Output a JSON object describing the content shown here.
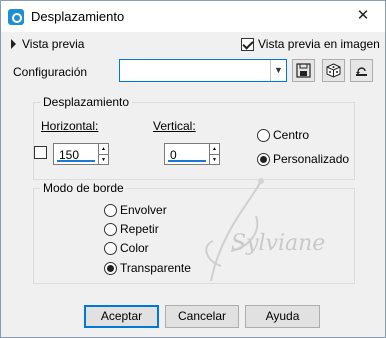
{
  "window": {
    "title": "Desplazamiento",
    "close_glyph": "✕"
  },
  "preview": {
    "toggle_label": "Vista previa",
    "image_preview_label": "Vista previa en imagen",
    "image_preview_checked": true
  },
  "config": {
    "label": "Configuración",
    "value": ""
  },
  "offset_group": {
    "title": "Desplazamiento",
    "horizontal_label": "Horizontal:",
    "vertical_label": "Vertical:",
    "horizontal_value": "150",
    "vertical_value": "0",
    "center_label": "Centro",
    "custom_label": "Personalizado",
    "selected": "custom"
  },
  "edge_group": {
    "title": "Modo de borde",
    "options": [
      {
        "label": "Envolver",
        "selected": false
      },
      {
        "label": "Repetir",
        "selected": false
      },
      {
        "label": "Color",
        "selected": false
      },
      {
        "label": "Transparente",
        "selected": true
      }
    ]
  },
  "watermark": {
    "text": "Sylviane"
  },
  "buttons": {
    "ok": "Aceptar",
    "cancel": "Cancelar",
    "help": "Ayuda"
  },
  "colors": {
    "accent": "#0078d7",
    "window_bg": "#f0f0f0"
  },
  "icons": [
    "save-icon",
    "random-icon",
    "reset-icon"
  ]
}
